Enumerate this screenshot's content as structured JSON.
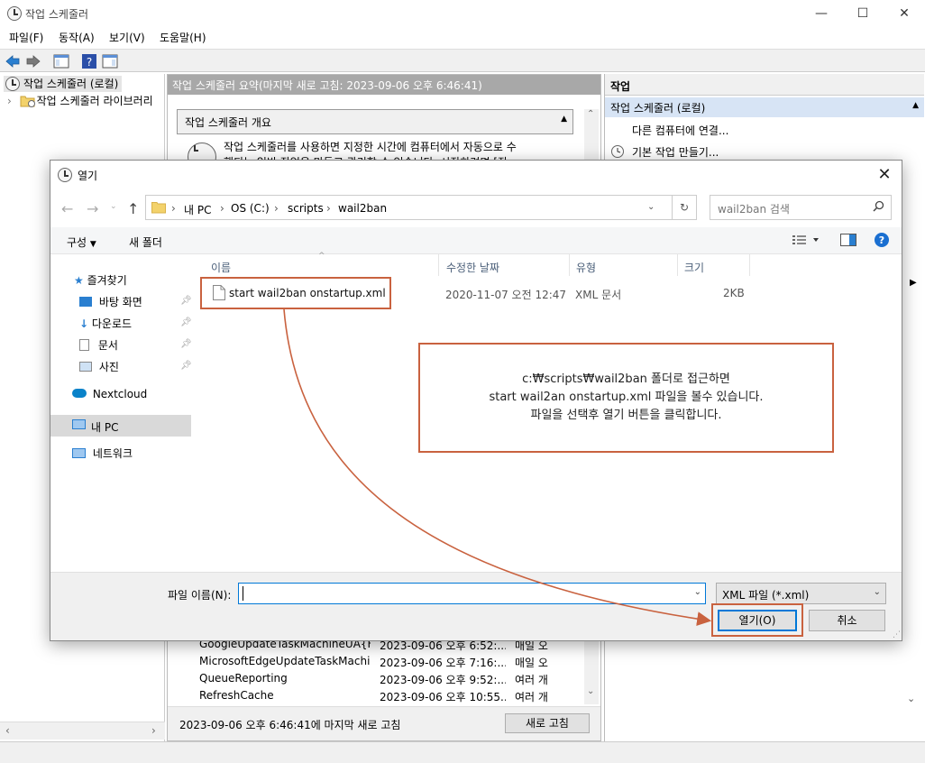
{
  "app": {
    "title": "작업 스케줄러",
    "menus": [
      "파일(F)",
      "동작(A)",
      "보기(V)",
      "도움말(H)"
    ],
    "window_controls": {
      "minimize": "—",
      "maximize": "☐",
      "close": "✕"
    }
  },
  "tree": {
    "items": [
      {
        "label": "작업 스케줄러 (로컬)"
      },
      {
        "label": "작업 스케줄러 라이브러리"
      }
    ]
  },
  "center": {
    "header": "작업 스케줄러 요약(마지막 새로 고침: 2023-09-06 오후 6:46:41)",
    "overview_title": "작업 스케줄러 개요",
    "overview_text_1": "작업 스케줄러를 사용하면 지정한 시간에 컴퓨터에서 자동으로 수",
    "overview_text_2": "행되는 일반 작업을 만들고 관리할 수 있습니다. 시작하려면 [작",
    "tasks": [
      {
        "name": "GoogleUpdateTaskMachineUA{F2...",
        "time": "2023-09-06 오후 6:52:...",
        "trigger": "매일 오"
      },
      {
        "name": "MicrosoftEdgeUpdateTaskMachin...",
        "time": "2023-09-06 오후 7:16:...",
        "trigger": "매일 오"
      },
      {
        "name": "QueueReporting",
        "time": "2023-09-06 오후 9:52:...",
        "trigger": "여러 개"
      },
      {
        "name": "RefreshCache",
        "time": "2023-09-06 오후 10:55...",
        "trigger": "여러 개"
      }
    ],
    "last_refresh": "2023-09-06 오후 6:46:41에 마지막 새로 고침",
    "refresh_button": "새로 고침"
  },
  "actions_pane": {
    "header": "작업",
    "section": "작업 스케줄러 (로컬)",
    "items": [
      "다른 컴퓨터에 연결...",
      "기본 작업 만들기..."
    ]
  },
  "dialog": {
    "title": "열기",
    "breadcrumbs": [
      "내 PC",
      "OS (C:)",
      "scripts",
      "wail2ban"
    ],
    "search_placeholder": "wail2ban 검색",
    "organize_label": "구성",
    "new_folder_label": "새 폴더",
    "nav": {
      "quick_access": "즐겨찾기",
      "desktop": "바탕 화면",
      "downloads": "다운로드",
      "documents": "문서",
      "pictures": "사진",
      "nextcloud": "Nextcloud",
      "this_pc": "내 PC",
      "network": "네트워크"
    },
    "columns": {
      "name": "이름",
      "modified": "수정한 날짜",
      "type": "유형",
      "size": "크기"
    },
    "files": [
      {
        "name": "start wail2ban onstartup.xml",
        "modified": "2020-11-07 오전 12:47",
        "type": "XML 문서",
        "size": "2KB"
      }
    ],
    "file_name_label": "파일 이름(N):",
    "file_name_value": "",
    "file_type": "XML 파일 (*.xml)",
    "open_button": "열기(O)",
    "cancel_button": "취소"
  },
  "annotation": {
    "line1": "c:₩scripts₩wail2ban 폴더로 접근하면",
    "line2": "start wail2an onstartup.xml 파일을 볼수 있습니다.",
    "line3": "파일을 선택후 열기 버튼을 클릭합니다.",
    "color": "#c9623f"
  }
}
